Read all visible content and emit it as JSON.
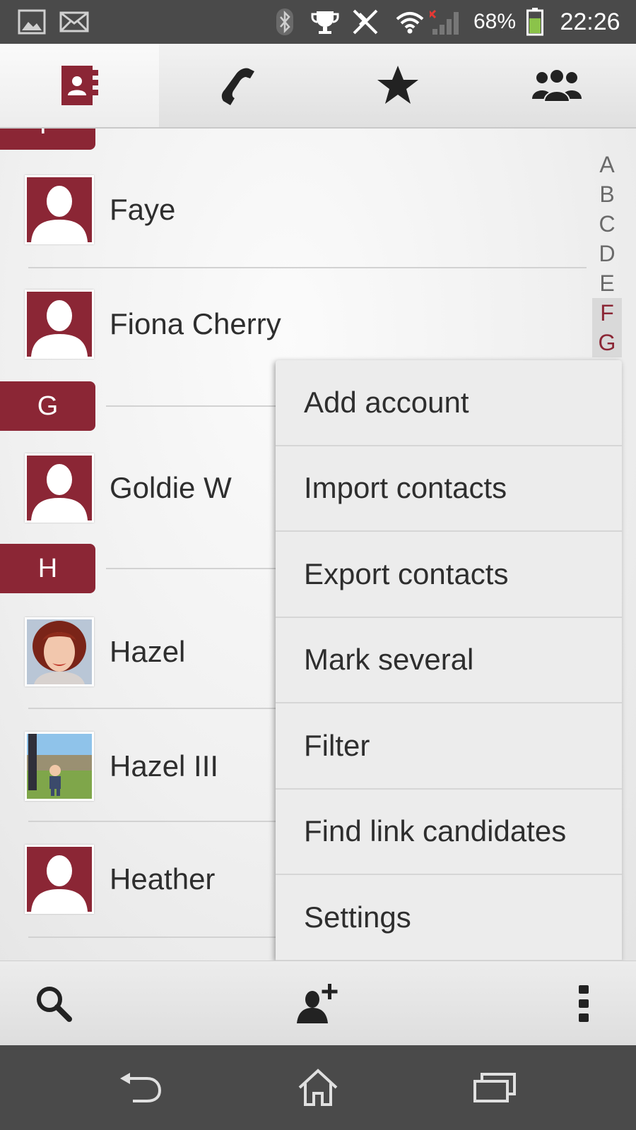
{
  "status_bar": {
    "battery_percent": "68%",
    "time": "22:26",
    "battery_level": 0.68,
    "icons": [
      "image-notification-icon",
      "email-notification-icon",
      "bluetooth-icon",
      "trophy-icon",
      "nfc-icon",
      "wifi-icon",
      "signal-icon",
      "battery-icon"
    ]
  },
  "tabs": [
    {
      "name": "contacts",
      "icon": "contacts-book-icon",
      "active": true
    },
    {
      "name": "phone",
      "icon": "phone-icon",
      "active": false
    },
    {
      "name": "favorites",
      "icon": "star-icon",
      "active": false
    },
    {
      "name": "groups",
      "icon": "groups-icon",
      "active": false
    }
  ],
  "list": {
    "sections": [
      {
        "letter": "F"
      },
      {
        "letter": "G"
      },
      {
        "letter": "H"
      }
    ],
    "contacts": [
      {
        "name": "Faye",
        "avatar": "default-avatar-icon"
      },
      {
        "name": "Fiona Cherry",
        "avatar": "default-avatar-icon"
      },
      {
        "name": "Goldie W",
        "avatar": "default-avatar-icon"
      },
      {
        "name": "Hazel",
        "avatar": "photo-avatar-portrait"
      },
      {
        "name": "Hazel III",
        "avatar": "photo-avatar-outdoor"
      },
      {
        "name": "Heather",
        "avatar": "default-avatar-icon"
      }
    ]
  },
  "alphabet_index": [
    "A",
    "B",
    "C",
    "D",
    "E",
    "F",
    "G"
  ],
  "alphabet_highlight": [
    "F",
    "G"
  ],
  "menu": {
    "items": [
      "Add account",
      "Import contacts",
      "Export contacts",
      "Mark several",
      "Filter",
      "Find link candidates",
      "Settings"
    ]
  },
  "action_bar": {
    "buttons": [
      "search-icon",
      "add-contact-icon",
      "overflow-menu-icon"
    ]
  },
  "nav_bar": {
    "buttons": [
      "back-icon",
      "home-icon",
      "recent-apps-icon"
    ]
  },
  "colors": {
    "accent": "#8b2635",
    "status_bar_bg": "#4a4a4a",
    "battery_fill": "#8bc34a"
  }
}
